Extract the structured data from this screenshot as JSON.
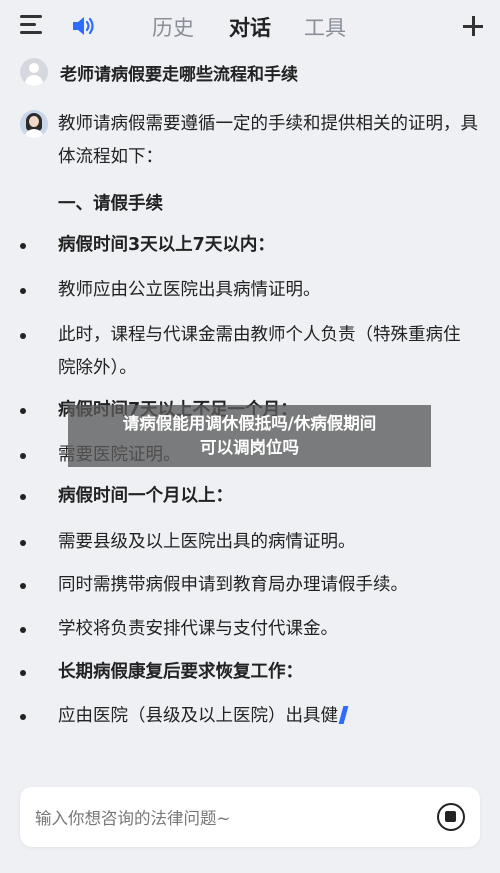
{
  "header": {
    "tabs": [
      {
        "label": "历史",
        "active": false
      },
      {
        "label": "对话",
        "active": true
      },
      {
        "label": "工具",
        "active": false
      }
    ],
    "icons": [
      "menu-icon",
      "speaker-icon",
      "plus-icon"
    ]
  },
  "question": {
    "text": "老师请病假要走哪些流程和手续"
  },
  "answer": {
    "intro": "教师请病假需要遵循一定的手续和提供相关的证明，具体流程如下：",
    "section_title": "一、请假手续",
    "bullets": [
      {
        "text": "病假时间3天以上7天以内：",
        "bold": true
      },
      {
        "text": "教师应由公立医院出具病情证明。",
        "bold": false
      },
      {
        "text": "此时，课程与代课金需由教师个人负责（特殊重病住院除外）。",
        "bold": false
      },
      {
        "text": "病假时间7天以上不足一个月：",
        "bold": true
      },
      {
        "text": "需要医院证明。",
        "bold": false
      },
      {
        "text": "病假时间一个月以上：",
        "bold": true
      },
      {
        "text": "需要县级及以上医院出具的病情证明。",
        "bold": false
      },
      {
        "text": "同时需携带病假申请到教育局办理请假手续。",
        "bold": false
      },
      {
        "text": "学校将负责安排代课与支付代课金。",
        "bold": false
      },
      {
        "text": "长期病假康复后要求恢复工作：",
        "bold": true
      },
      {
        "text": "应由医院（县级及以上医院）出具健",
        "bold": false
      }
    ]
  },
  "watermark": {
    "line1": "请病假能用调休假抵吗/休病假期间",
    "line2": "可以调岗位吗"
  },
  "input": {
    "placeholder": "输入你想咨询的法律问题~",
    "value": ""
  },
  "colors": {
    "background": "#eef0f4",
    "active_tab": "#222222",
    "inactive_tab": "#8a8f98",
    "accent": "#2e6bff"
  }
}
